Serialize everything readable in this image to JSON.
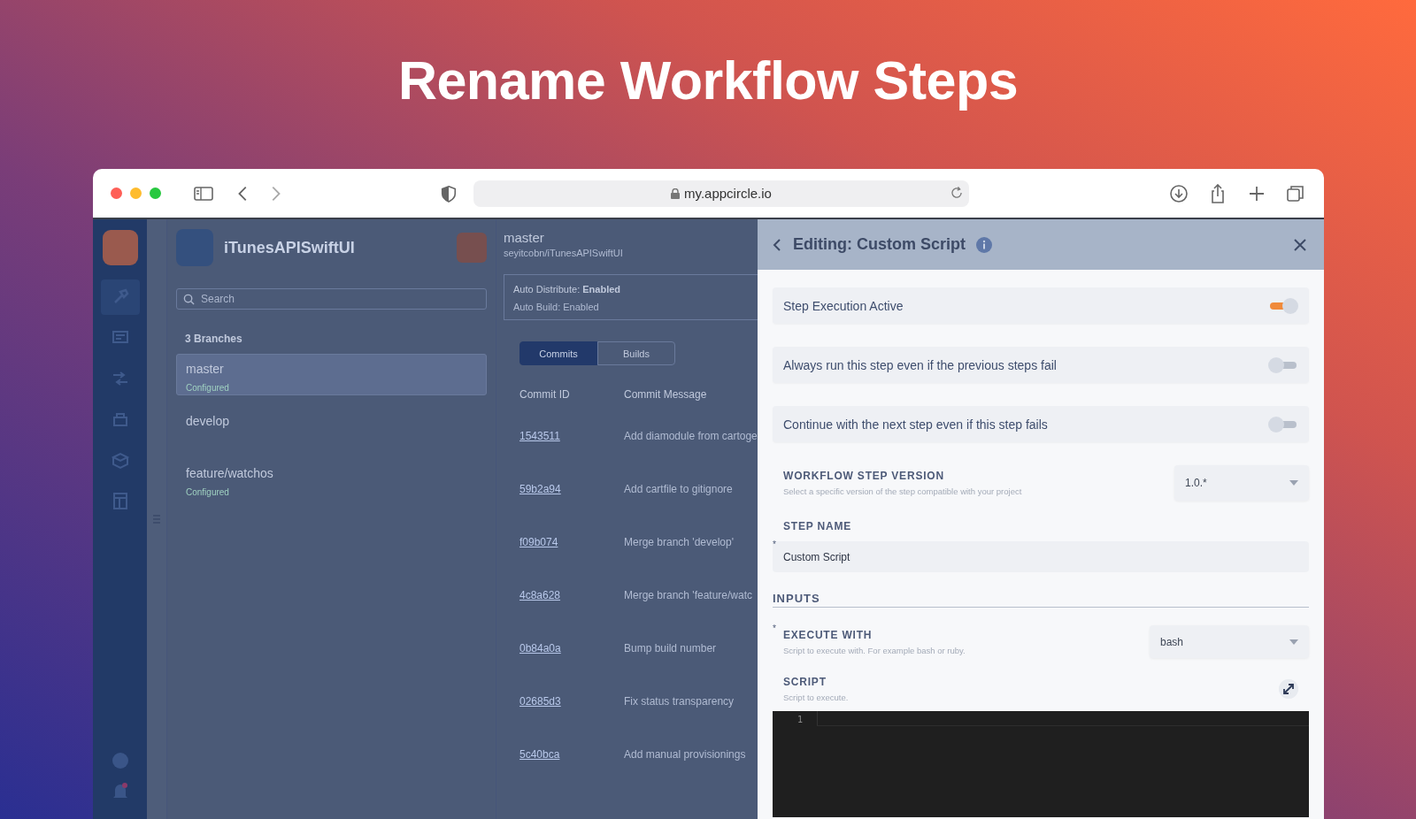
{
  "page_title": "Rename Workflow Steps",
  "browser": {
    "url": "my.appcircle.io"
  },
  "sidebar": {
    "items": [
      {
        "selected": true
      },
      {
        "selected": false
      },
      {
        "selected": false
      },
      {
        "selected": false
      },
      {
        "selected": false
      },
      {
        "selected": false
      }
    ]
  },
  "app": {
    "name": "iTunesAPISwiftUI",
    "search": {
      "placeholder": "Search"
    },
    "branches_heading": "3 Branches",
    "branches": [
      {
        "name": "master",
        "status": "Configured",
        "selected": true
      },
      {
        "name": "develop",
        "selected": false
      },
      {
        "name": "feature/watchos",
        "status": "Configured",
        "selected": false
      }
    ]
  },
  "branch_detail": {
    "name": "master",
    "repo": "seyitcobn/iTunesAPISwiftUI",
    "auto_distribute_label": "Auto Distribute:",
    "auto_distribute_value": "Enabled",
    "auto_build": "Auto Build: Enabled",
    "tabs": [
      {
        "label": "Commits",
        "selected": true
      },
      {
        "label": "Builds",
        "selected": false
      }
    ],
    "columns": [
      "Commit ID",
      "Commit Message"
    ],
    "commits": [
      {
        "id": "1543511",
        "message": "Add diamodule from cartoge"
      },
      {
        "id": "59b2a94",
        "message": "Add cartfile to gitignore"
      },
      {
        "id": "f09b074",
        "message": "Merge branch 'develop'"
      },
      {
        "id": "4c8a628",
        "message": "Merge branch 'feature/watc"
      },
      {
        "id": "0b84a0a",
        "message": "Bump build number"
      },
      {
        "id": "02685d3",
        "message": "Fix status transparency"
      },
      {
        "id": "5c40bca",
        "message": "Add manual provisionings"
      }
    ]
  },
  "drawer": {
    "title": "Editing: Custom Script",
    "toggles": [
      {
        "label": "Step Execution Active",
        "on": true
      },
      {
        "label": "Always run this step even if the previous steps fail",
        "on": false
      },
      {
        "label": "Continue with the next step even if this step fails",
        "on": false
      }
    ],
    "version": {
      "label": "WORKFLOW STEP VERSION",
      "hint": "Select a specific version of the step compatible with your project",
      "value": "1.0.*"
    },
    "step_name": {
      "label": "STEP NAME",
      "required_mark": "*",
      "value": "Custom Script"
    },
    "section": "INPUTS",
    "execute_with": {
      "label": "EXECUTE WITH",
      "required_mark": "*",
      "hint": "Script to execute with. For example bash or ruby.",
      "value": "bash"
    },
    "script": {
      "label": "SCRIPT",
      "hint": "Script to execute.",
      "line_numbers": [
        "1"
      ]
    }
  }
}
